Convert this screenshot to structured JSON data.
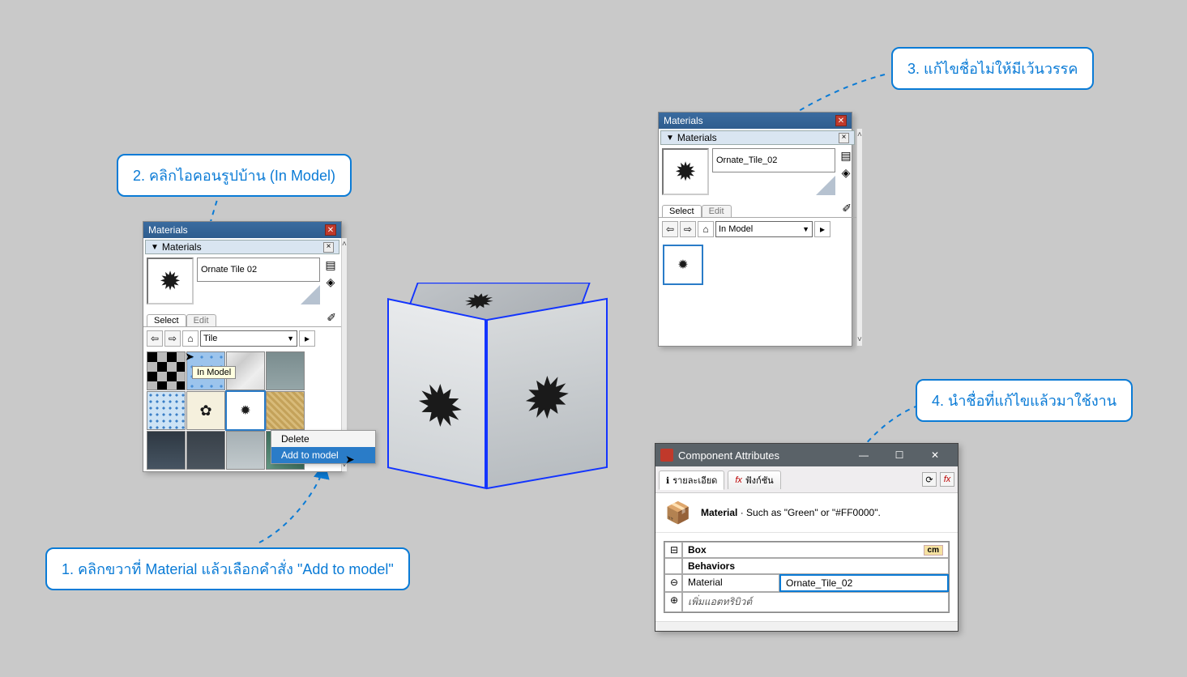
{
  "callouts": {
    "c1": "1. คลิกขวาที่ Material แล้วเลือกคำสั่ง \"Add to model\"",
    "c2": "2. คลิกไอคอนรูปบ้าน (In Model)",
    "c3": "3. แก้ไขชื่อไม่ให้มีเว้นวรรค",
    "c4": "4. นำชื่อที่แก้ไขแล้วมาใช้งาน"
  },
  "materials_left": {
    "panel_title": "Materials",
    "tray_header": "Materials",
    "material_name": "Ornate Tile 02",
    "tab_select": "Select",
    "tab_edit": "Edit",
    "nav_home_tooltip": "In Model",
    "library_dropdown": "Tile",
    "context_menu": {
      "delete": "Delete",
      "add_to_model": "Add to model"
    }
  },
  "materials_right": {
    "panel_title": "Materials",
    "tray_header": "Materials",
    "material_name": "Ornate_Tile_02",
    "tab_select": "Select",
    "tab_edit": "Edit",
    "library_dropdown": "In Model"
  },
  "component_attributes": {
    "title": "Component Attributes",
    "tab_detail": "รายละเอียด",
    "tab_function": "ฟังก์ชัน",
    "desc_prefix": "Material",
    "desc_body": " · Such as \"Green\" or \"#FF0000\".",
    "row_box": "Box",
    "row_unit": "cm",
    "row_behaviors": "Behaviors",
    "row_material": "Material",
    "row_material_value": "Ornate_Tile_02",
    "row_add_attr": "เพิ่มแอตทริบิวต์"
  }
}
